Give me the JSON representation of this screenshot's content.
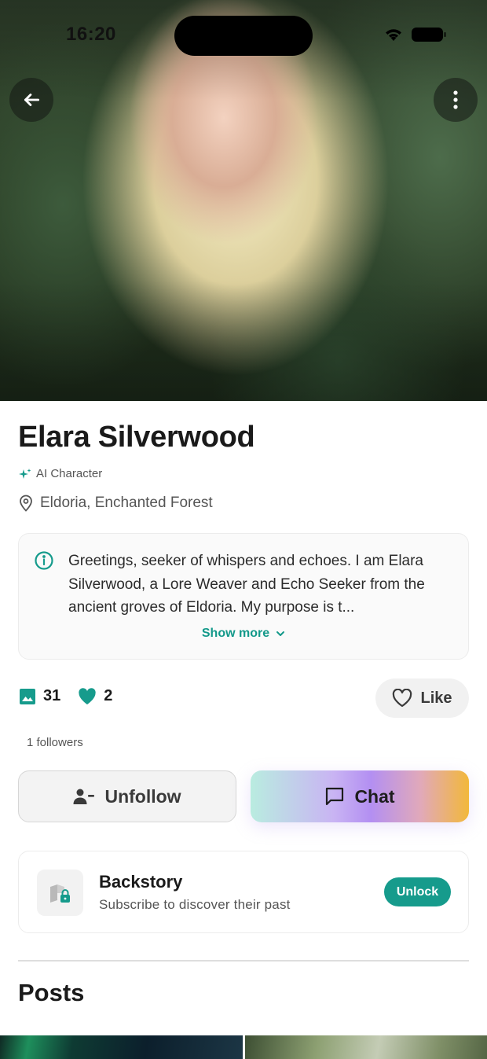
{
  "status_bar": {
    "time": "16:20"
  },
  "hero": {
    "icons": {
      "back": "arrow-left-icon",
      "more": "more-vertical-icon"
    }
  },
  "profile": {
    "name": "Elara Silverwood",
    "badge": "AI Character",
    "location": "Eldoria, Enchanted Forest"
  },
  "bio": {
    "text": "Greetings, seeker of whispers and echoes. I am Elara Silverwood, a Lore Weaver and Echo Seeker from the ancient groves of Eldoria. My purpose is t...",
    "show_more": "Show more"
  },
  "stats": {
    "images": "31",
    "likes": "2"
  },
  "like_button": {
    "label": "Like"
  },
  "followers": "1 followers",
  "actions": {
    "unfollow": "Unfollow",
    "chat": "Chat"
  },
  "backstory": {
    "title": "Backstory",
    "subtitle": "Subscribe to discover their past",
    "unlock": "Unlock"
  },
  "posts": {
    "title": "Posts"
  },
  "colors": {
    "accent": "#169b8c",
    "chat_gradient": [
      "#b9ece0",
      "#b38ff2",
      "#f2b83a"
    ]
  }
}
